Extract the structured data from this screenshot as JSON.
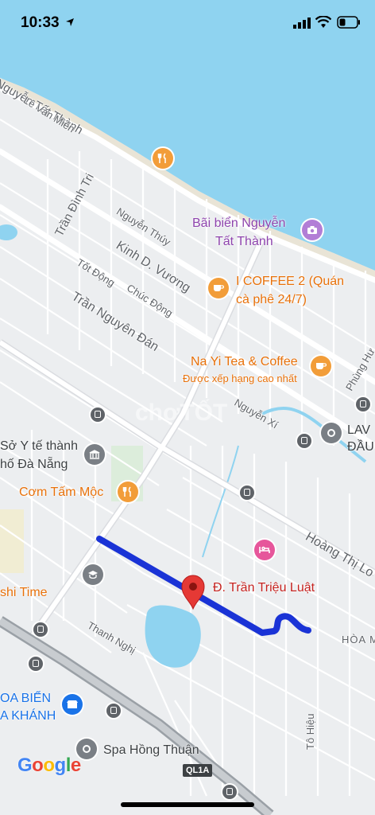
{
  "status_bar": {
    "time": "10:33"
  },
  "streets": {
    "nguyen_tat_thanh": "Nguyễn Tất Thành",
    "le_van_mien": "Lê Văn Miến",
    "tran_dinh_tri": "Trần Đình Tri",
    "nguyen_thuy": "Nguyễn Thúy",
    "kinh_d_vuong": "Kinh D. Vương",
    "tot_dong": "Tốt Động",
    "chuc_dong": "Chúc Động",
    "tran_nguyen_dan": "Trần Nguyên Đán",
    "nguyen_xi": "Nguyễn Xí",
    "phung_hung": "Phùng Hư",
    "hoang_thi_loan": "Hoàng Thị Lo",
    "thanh_nghi": "Thanh Nghị",
    "to_hieu": "Tô Hiệu",
    "hoa_m": "HÒA M",
    "ql1a": "QL1A"
  },
  "pois": {
    "beach_line1": "Bãi biển Nguyễn",
    "beach_line2": "Tất Thành",
    "coffee_line1": "I COFFEE 2 (Quán",
    "coffee_line2": "cà phê 24/7)",
    "nayi": "Na Yi Tea & Coffee",
    "nayi_sub": "Được xếp hạng cao nhất",
    "soyte_line1": "Sở Y tế thành",
    "soyte_line2": "hố Đà Nẵng",
    "comtam": "Cơm Tấm Mộc",
    "sushi": "shi Time",
    "lav_line1": "LAV",
    "lav_line2": "ĐẦU",
    "hoabien_line1": "OA BIỂN",
    "hoabien_line2": "A KHÁNH",
    "spa": "Spa Hồng Thuận",
    "pin_label": "Đ. Trần Triệu Luật"
  },
  "watermark": "chợTỐT",
  "google_logo": [
    "G",
    "o",
    "o",
    "g",
    "l",
    "e"
  ],
  "colors": {
    "sea": "#8fd3f0",
    "route": "#1a33d6",
    "pin": "#e53935"
  }
}
